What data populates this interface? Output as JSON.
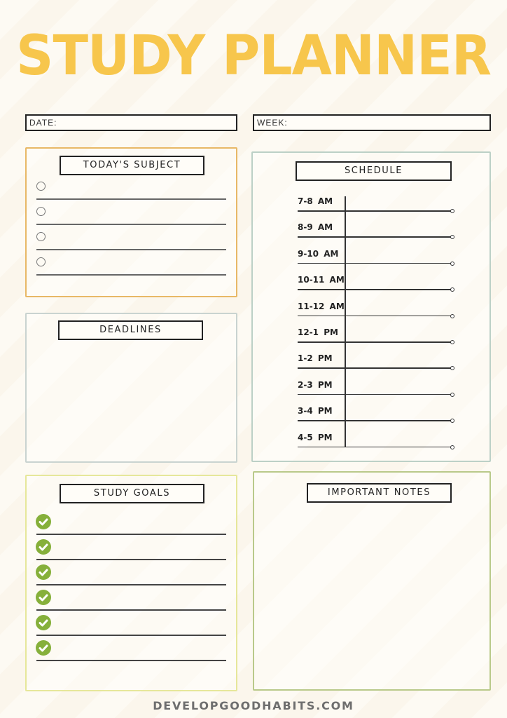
{
  "title": "STUDY PLANNER",
  "fields": {
    "date_label": "DATE:",
    "week_label": "WEEK:"
  },
  "panels": {
    "todays_subject": {
      "heading": "TODAY'S SUBJECT",
      "rows": 4,
      "border_color": "#e8b866"
    },
    "deadlines": {
      "heading": "DEADLINES",
      "border_color": "#c9d3d0"
    },
    "study_goals": {
      "heading": "STUDY GOALS",
      "rows": 6,
      "border_color": "#e6e79a",
      "check_color": "#86b03b"
    },
    "schedule": {
      "heading": "SCHEDULE",
      "border_color": "#bcd0c6",
      "slots": [
        "7-8 AM",
        "8-9 AM",
        "9-10  AM",
        "10-11  AM",
        "11-12  AM",
        "12-1  PM",
        "1-2  PM",
        "2-3  PM",
        "3-4  PM",
        "4-5  PM"
      ]
    },
    "important_notes": {
      "heading": "IMPORTANT NOTES",
      "border_color": "#b9c98a"
    }
  },
  "colors": {
    "title": "#f7c64c",
    "footer": "#6e6e6e"
  },
  "footer": "DEVELOPGOODHABITS.COM"
}
